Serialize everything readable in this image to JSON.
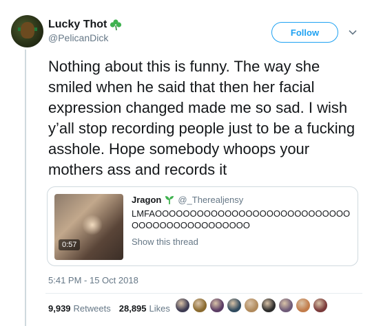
{
  "author": {
    "display_name": "Lucky Thot",
    "handle": "@PelicanDick",
    "emoji": "shamrock-icon"
  },
  "follow_label": "Follow",
  "tweet_text": "Nothing about this is funny. The way she smiled when he said that then her facial expression changed made me so sad. I wish y’all stop recording people just to be a fucking asshole. Hope somebody whoops your mothers ass and records it",
  "quoted": {
    "display_name": "Jragon",
    "emoji": "seedling-icon",
    "handle": "@_Therealjensy",
    "text": "LMFAOOOOOOOOOOOOOOOOOOOOOOOOOOOOOOOOOOOOOOOOOOOOO",
    "show_thread": "Show this thread",
    "video_duration": "0:57"
  },
  "timestamp": "5:41 PM - 15 Oct 2018",
  "stats": {
    "retweets_count": "9,939",
    "retweets_label": "Retweets",
    "likes_count": "28,895",
    "likes_label": "Likes"
  },
  "colors": {
    "accent": "#1da1f2",
    "secondary_text": "#657786",
    "liker_avatars": [
      "#3d3b52",
      "#8a6a2f",
      "#5a3c64",
      "#2f4a5e",
      "#b08a5c",
      "#2b2b2b",
      "#6e5a78",
      "#c27c4a",
      "#7a3a3a"
    ]
  }
}
